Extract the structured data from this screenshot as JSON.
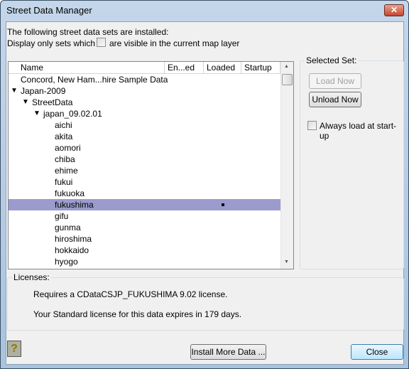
{
  "window": {
    "title": "Street Data Manager",
    "close_icon": "close-icon"
  },
  "intro": {
    "line1": "The following street data sets are installed:",
    "line2": "Display only sets which",
    "visible_checkbox_label": "are visible in the current map layer",
    "visible_checked": false
  },
  "list": {
    "columns": [
      "Name",
      "En...ed",
      "Loaded",
      "Startup"
    ],
    "rows": [
      {
        "label": "Concord, New Ham...hire Sample Data",
        "level": 0,
        "expander": false
      },
      {
        "label": "Japan-2009",
        "level": 0,
        "expander": true
      },
      {
        "label": "StreetData",
        "level": 1,
        "expander": true
      },
      {
        "label": "japan_09.02.01",
        "level": 2,
        "expander": true
      },
      {
        "label": "aichi",
        "level": 3
      },
      {
        "label": "akita",
        "level": 3
      },
      {
        "label": "aomori",
        "level": 3
      },
      {
        "label": "chiba",
        "level": 3
      },
      {
        "label": "ehime",
        "level": 3
      },
      {
        "label": "fukui",
        "level": 3
      },
      {
        "label": "fukuoka",
        "level": 3
      },
      {
        "label": "fukushima",
        "level": 3,
        "selected": true,
        "loaded": true
      },
      {
        "label": "gifu",
        "level": 3
      },
      {
        "label": "gunma",
        "level": 3
      },
      {
        "label": "hiroshima",
        "level": 3
      },
      {
        "label": "hokkaido",
        "level": 3
      },
      {
        "label": "hyogo",
        "level": 3
      }
    ],
    "selection_color": "#9b9bcd"
  },
  "selected_set": {
    "title": "Selected Set:",
    "load_now": "Load Now",
    "unload_now": "Unload Now",
    "always_load_label": "Always load at start-up",
    "always_load_checked": false
  },
  "licenses": {
    "title": "Licenses:",
    "line1": "Requires a CDataCSJP_FUKUSHIMA 9.02 license.",
    "line2": "Your Standard license for this data expires in 179 days."
  },
  "footer": {
    "help_label": "?",
    "install_more": "Install More Data ...",
    "close": "Close"
  }
}
